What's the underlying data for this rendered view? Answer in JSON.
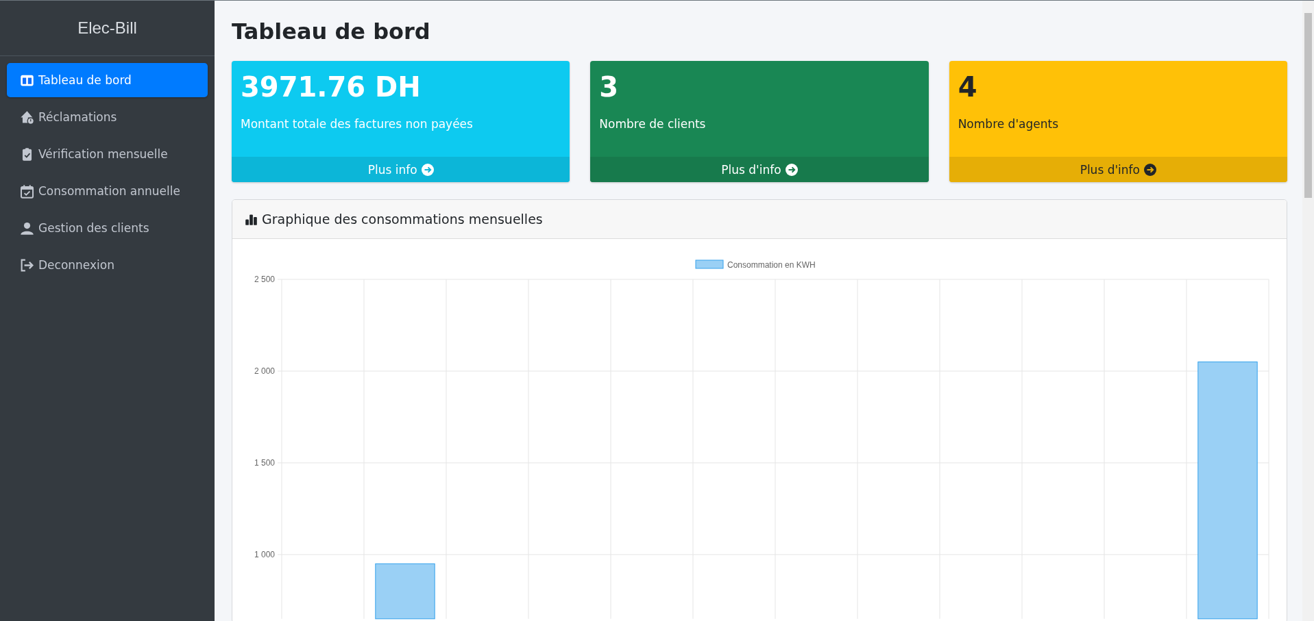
{
  "sidebar": {
    "brand": "Elec-Bill",
    "items": [
      {
        "label": "Tableau de bord",
        "selected": true
      },
      {
        "label": "Réclamations",
        "selected": false
      },
      {
        "label": "Vérification mensuelle",
        "selected": false
      },
      {
        "label": "Consommation annuelle",
        "selected": false
      },
      {
        "label": "Gestion des clients",
        "selected": false
      },
      {
        "label": "Deconnexion",
        "selected": false
      }
    ]
  },
  "page_title": "Tableau de bord",
  "stat_cards": [
    {
      "value": "3971.76 DH",
      "label": "Montant totale des factures non payées",
      "link": "Plus info",
      "color": "#0dcaf0"
    },
    {
      "value": "3",
      "label": "Nombre de clients",
      "link": "Plus d'info",
      "color": "#198754"
    },
    {
      "value": "4",
      "label": "Nombre d'agents",
      "link": "Plus d'info",
      "color": "#ffc107"
    }
  ],
  "chart_card": {
    "title": "Graphique des consommations mensuelles",
    "chart_data": {
      "type": "bar",
      "series": [
        {
          "name": "Consommation en KWH",
          "color": "#9ad0f5",
          "values": [
            null,
            950,
            null,
            null,
            null,
            null,
            null,
            null,
            null,
            null,
            null,
            2050
          ]
        }
      ],
      "grid": true,
      "ylim": [
        650,
        2500
      ],
      "yticks": [
        {
          "value": 1000,
          "label": "1 000"
        },
        {
          "value": 1500,
          "label": "1 500"
        },
        {
          "value": 2000,
          "label": "2 000"
        },
        {
          "value": 2500,
          "label": "2 500"
        }
      ]
    }
  }
}
